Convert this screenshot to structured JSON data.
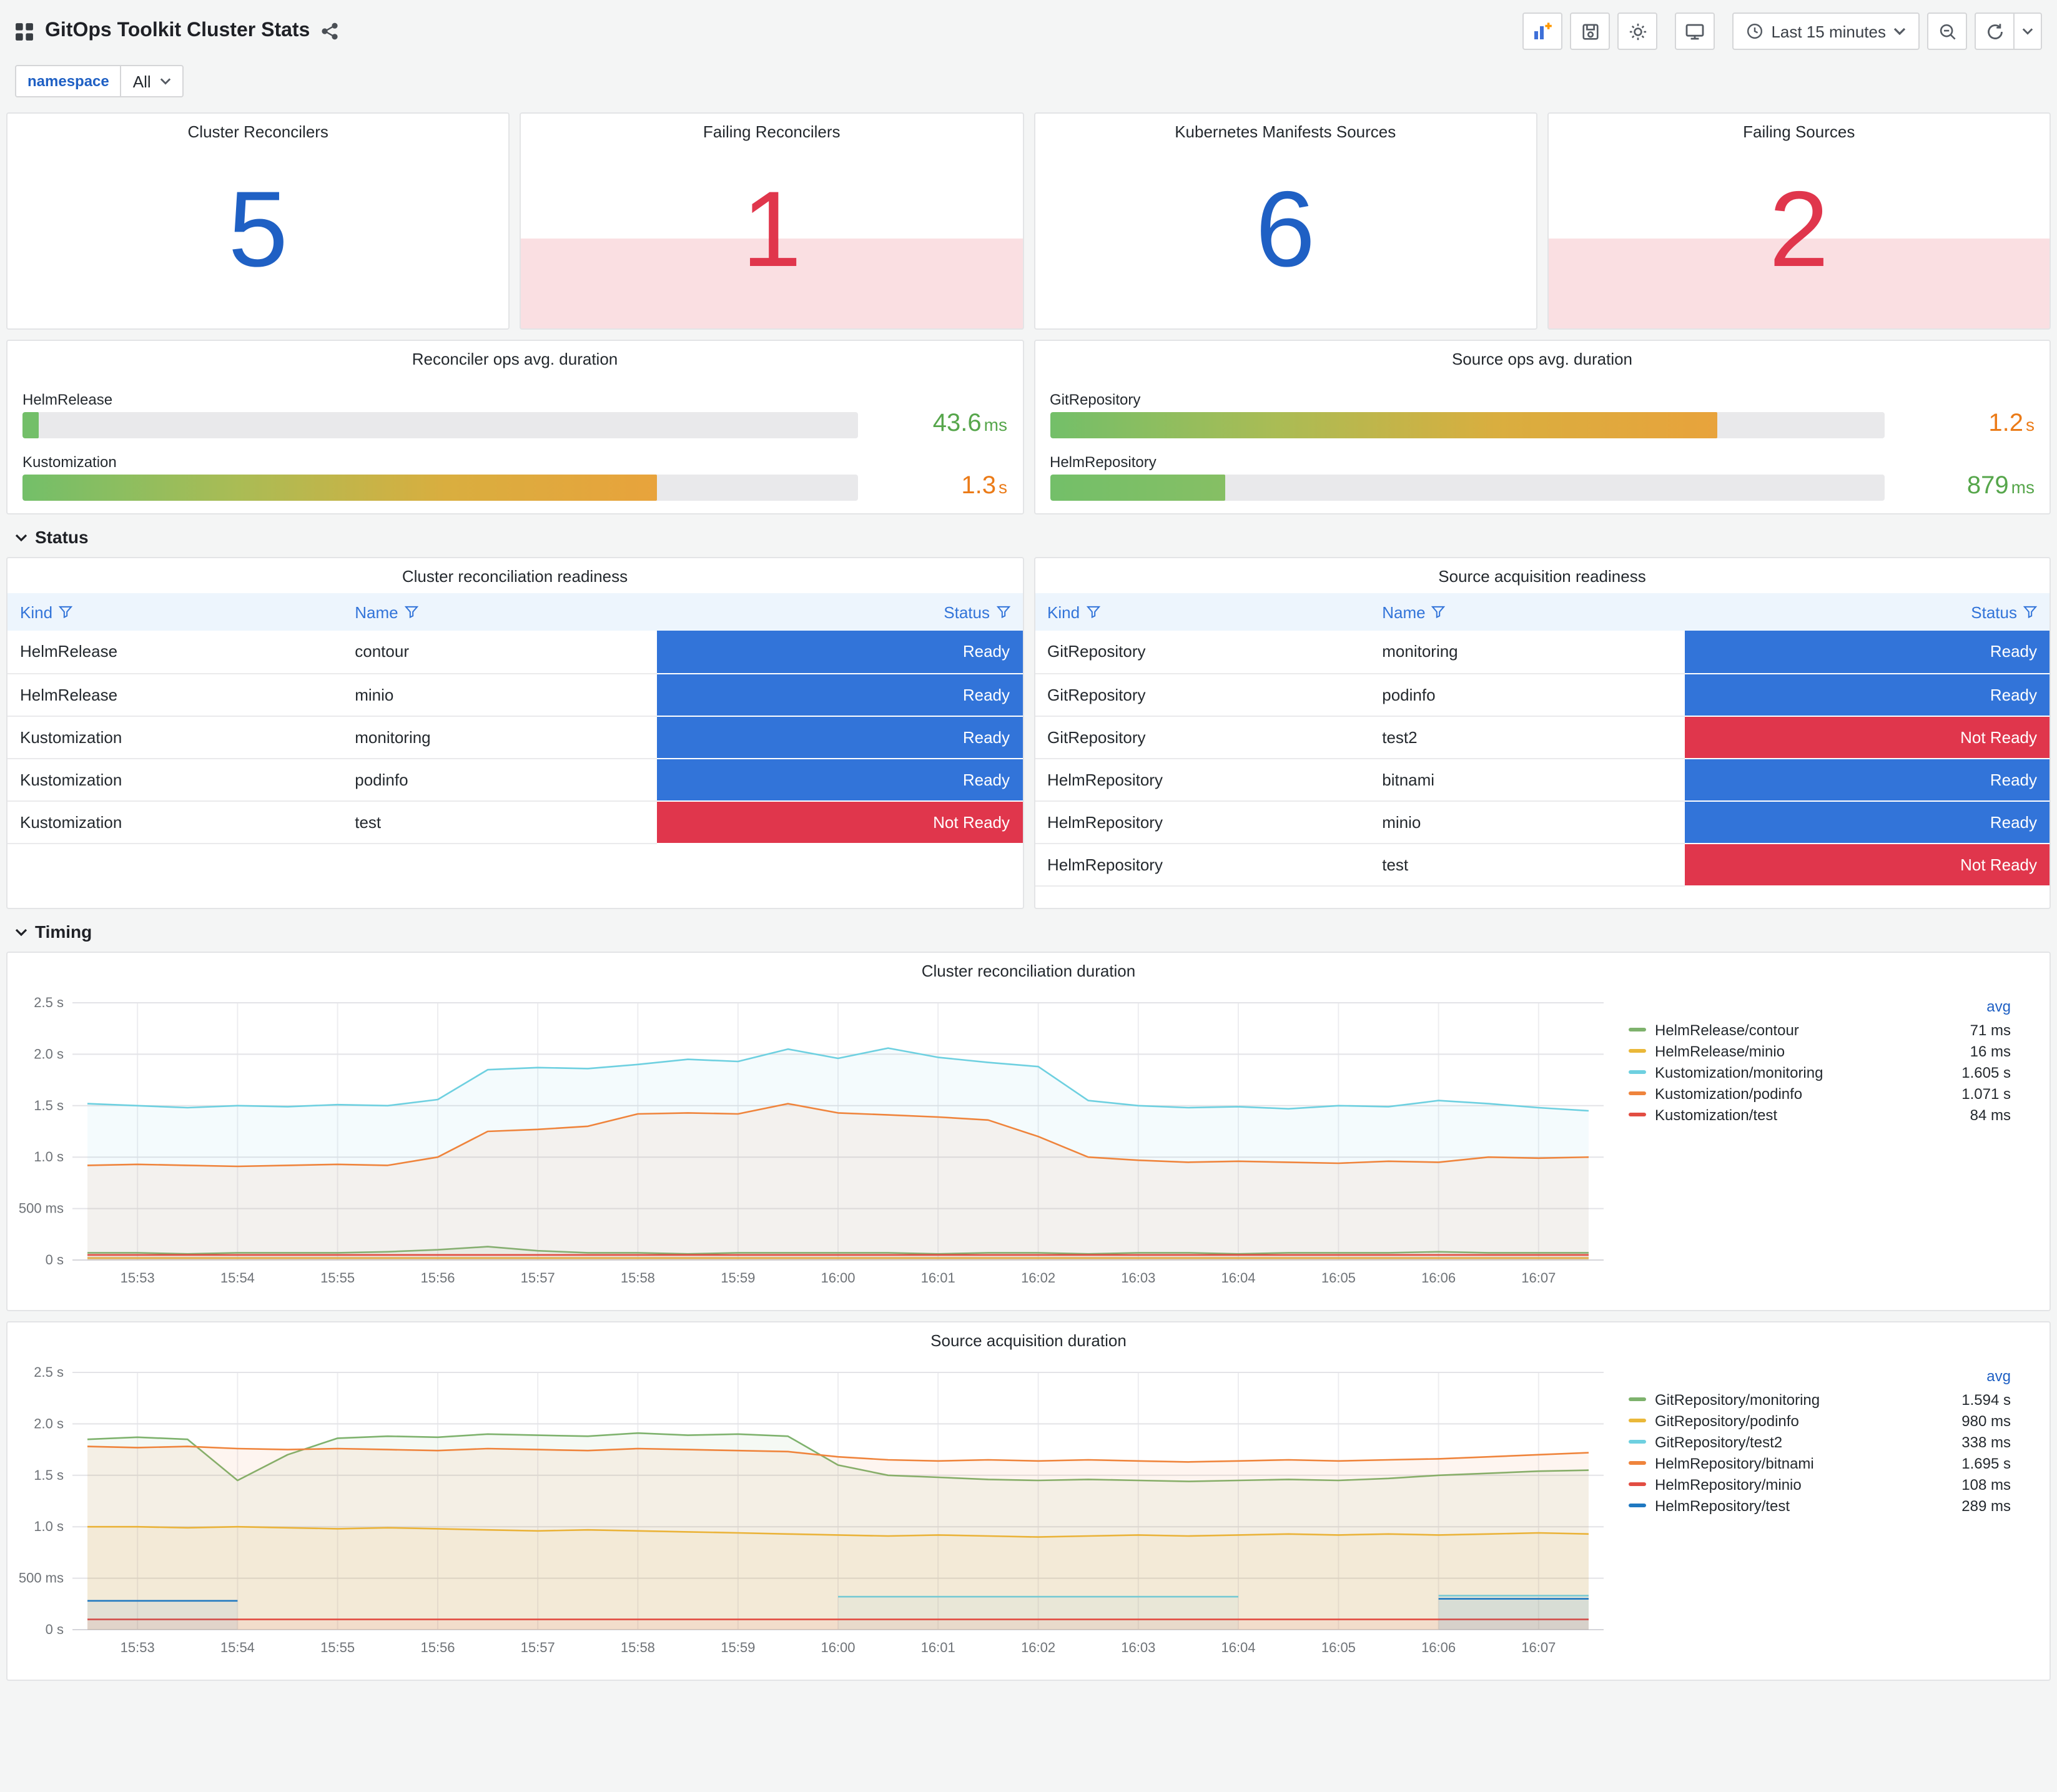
{
  "header": {
    "title": "GitOps Toolkit Cluster Stats",
    "time_range_label": "Last 15 minutes"
  },
  "variables": {
    "namespace_label": "namespace",
    "namespace_value": "All"
  },
  "colors": {
    "stat_ok": "#1F60C4",
    "stat_alert": "#E0364C",
    "ready_bg": "#3274D9",
    "not_ready_bg": "#E0364C",
    "gauge_green": "#73BF69",
    "gauge_orange": "#E8A33C"
  },
  "stats": [
    {
      "title": "Cluster Reconcilers",
      "value": "5",
      "state": "ok"
    },
    {
      "title": "Failing Reconcilers",
      "value": "1",
      "state": "alerting"
    },
    {
      "title": "Kubernetes Manifests Sources",
      "value": "6",
      "state": "ok"
    },
    {
      "title": "Failing Sources",
      "value": "2",
      "state": "alerting"
    }
  ],
  "gauges": [
    {
      "title": "Reconciler ops avg. duration",
      "rows": [
        {
          "label": "HelmRelease",
          "value": "43.6",
          "unit": "ms",
          "fill_pct": 2,
          "bar_colors": [
            "#73BF69",
            "#73BF69"
          ],
          "value_color": "#56A64B"
        },
        {
          "label": "Kustomization",
          "value": "1.3",
          "unit": "s",
          "fill_pct": 76,
          "bar_colors": [
            "#73BF69",
            "#A9BC55",
            "#D9AE3F",
            "#E8A33C"
          ],
          "value_color": "#EB7B18"
        }
      ]
    },
    {
      "title": "Source ops avg. duration",
      "rows": [
        {
          "label": "GitRepository",
          "value": "1.2",
          "unit": "s",
          "fill_pct": 80,
          "bar_colors": [
            "#73BF69",
            "#A9BC55",
            "#D9AE3F",
            "#E8A33C"
          ],
          "value_color": "#EB7B18"
        },
        {
          "label": "HelmRepository",
          "value": "879",
          "unit": "ms",
          "fill_pct": 21,
          "bar_colors": [
            "#73BF69",
            "#86BF64"
          ],
          "value_color": "#56A64B"
        }
      ]
    }
  ],
  "sections": {
    "status": "Status",
    "timing": "Timing"
  },
  "tables": [
    {
      "title": "Cluster reconciliation readiness",
      "columns": [
        "Kind",
        "Name",
        "Status"
      ],
      "rows": [
        {
          "kind": "HelmRelease",
          "name": "contour",
          "status": "Ready"
        },
        {
          "kind": "HelmRelease",
          "name": "minio",
          "status": "Ready"
        },
        {
          "kind": "Kustomization",
          "name": "monitoring",
          "status": "Ready"
        },
        {
          "kind": "Kustomization",
          "name": "podinfo",
          "status": "Ready"
        },
        {
          "kind": "Kustomization",
          "name": "test",
          "status": "Not Ready"
        }
      ]
    },
    {
      "title": "Source acquisition readiness",
      "columns": [
        "Kind",
        "Name",
        "Status"
      ],
      "rows": [
        {
          "kind": "GitRepository",
          "name": "monitoring",
          "status": "Ready"
        },
        {
          "kind": "GitRepository",
          "name": "podinfo",
          "status": "Ready"
        },
        {
          "kind": "GitRepository",
          "name": "test2",
          "status": "Not Ready"
        },
        {
          "kind": "HelmRepository",
          "name": "bitnami",
          "status": "Ready"
        },
        {
          "kind": "HelmRepository",
          "name": "minio",
          "status": "Ready"
        },
        {
          "kind": "HelmRepository",
          "name": "test",
          "status": "Not Ready"
        }
      ]
    }
  ],
  "chart_data": [
    {
      "type": "line",
      "title": "Cluster reconciliation duration",
      "legend_header": "avg",
      "ylim": [
        0,
        2.5
      ],
      "ytick_values": [
        0,
        0.5,
        1.0,
        1.5,
        2.0,
        2.5
      ],
      "ytick_labels": [
        "0 s",
        "500 ms",
        "1.0 s",
        "1.5 s",
        "2.0 s",
        "2.5 s"
      ],
      "x_start": 52.5,
      "x_step": 0.5,
      "xticks": [
        {
          "v": 53,
          "label": "15:53"
        },
        {
          "v": 54,
          "label": "15:54"
        },
        {
          "v": 55,
          "label": "15:55"
        },
        {
          "v": 56,
          "label": "15:56"
        },
        {
          "v": 57,
          "label": "15:57"
        },
        {
          "v": 58,
          "label": "15:58"
        },
        {
          "v": 59,
          "label": "15:59"
        },
        {
          "v": 60,
          "label": "16:00"
        },
        {
          "v": 61,
          "label": "16:01"
        },
        {
          "v": 62,
          "label": "16:02"
        },
        {
          "v": 63,
          "label": "16:03"
        },
        {
          "v": 64,
          "label": "16:04"
        },
        {
          "v": 65,
          "label": "16:05"
        },
        {
          "v": 66,
          "label": "16:06"
        },
        {
          "v": 67,
          "label": "16:07"
        }
      ],
      "series": [
        {
          "name": "HelmRelease/contour",
          "color": "#7EB26D",
          "avg": "71 ms",
          "values": [
            0.07,
            0.07,
            0.06,
            0.07,
            0.07,
            0.07,
            0.08,
            0.1,
            0.13,
            0.09,
            0.07,
            0.07,
            0.06,
            0.07,
            0.07,
            0.07,
            0.07,
            0.06,
            0.07,
            0.07,
            0.06,
            0.07,
            0.07,
            0.06,
            0.07,
            0.07,
            0.07,
            0.08,
            0.07,
            0.07,
            0.07
          ]
        },
        {
          "name": "HelmRelease/minio",
          "color": "#EAB839",
          "avg": "16 ms",
          "values": [
            0.02,
            0.02,
            0.02,
            0.02,
            0.02,
            0.02,
            0.02,
            0.02,
            0.02,
            0.02,
            0.02,
            0.02,
            0.02,
            0.02,
            0.02,
            0.02,
            0.02,
            0.02,
            0.02,
            0.02,
            0.02,
            0.02,
            0.02,
            0.02,
            0.02,
            0.02,
            0.02,
            0.02,
            0.02,
            0.02,
            0.02
          ]
        },
        {
          "name": "Kustomization/monitoring",
          "color": "#6ED0E0",
          "avg": "1.605 s",
          "values": [
            1.52,
            1.5,
            1.48,
            1.5,
            1.49,
            1.51,
            1.5,
            1.56,
            1.85,
            1.87,
            1.86,
            1.9,
            1.95,
            1.93,
            2.05,
            1.96,
            2.06,
            1.97,
            1.92,
            1.88,
            1.55,
            1.5,
            1.48,
            1.49,
            1.47,
            1.5,
            1.49,
            1.55,
            1.52,
            1.48,
            1.45
          ]
        },
        {
          "name": "Kustomization/podinfo",
          "color": "#EF843C",
          "avg": "1.071 s",
          "values": [
            0.92,
            0.93,
            0.92,
            0.91,
            0.92,
            0.93,
            0.92,
            1.0,
            1.25,
            1.27,
            1.3,
            1.42,
            1.43,
            1.42,
            1.52,
            1.43,
            1.41,
            1.39,
            1.36,
            1.2,
            1.0,
            0.97,
            0.95,
            0.96,
            0.95,
            0.94,
            0.96,
            0.95,
            1.0,
            0.99,
            1.0
          ]
        },
        {
          "name": "Kustomization/test",
          "color": "#E24D42",
          "avg": "84 ms",
          "values": [
            0.05,
            0.05,
            0.05,
            0.05,
            0.05,
            0.05,
            0.05,
            0.05,
            0.05,
            0.05,
            0.05,
            0.05,
            0.05,
            0.05,
            0.05,
            0.05,
            0.05,
            0.05,
            0.05,
            0.05,
            0.05,
            0.05,
            0.05,
            0.05,
            0.05,
            0.05,
            0.05,
            0.05,
            0.05,
            0.05,
            0.05
          ]
        }
      ]
    },
    {
      "type": "line",
      "title": "Source acquisition duration",
      "legend_header": "avg",
      "ylim": [
        0,
        2.5
      ],
      "ytick_values": [
        0,
        0.5,
        1.0,
        1.5,
        2.0,
        2.5
      ],
      "ytick_labels": [
        "0 s",
        "500 ms",
        "1.0 s",
        "1.5 s",
        "2.0 s",
        "2.5 s"
      ],
      "x_start": 52.5,
      "x_step": 0.5,
      "xticks": [
        {
          "v": 53,
          "label": "15:53"
        },
        {
          "v": 54,
          "label": "15:54"
        },
        {
          "v": 55,
          "label": "15:55"
        },
        {
          "v": 56,
          "label": "15:56"
        },
        {
          "v": 57,
          "label": "15:57"
        },
        {
          "v": 58,
          "label": "15:58"
        },
        {
          "v": 59,
          "label": "15:59"
        },
        {
          "v": 60,
          "label": "16:00"
        },
        {
          "v": 61,
          "label": "16:01"
        },
        {
          "v": 62,
          "label": "16:02"
        },
        {
          "v": 63,
          "label": "16:03"
        },
        {
          "v": 64,
          "label": "16:04"
        },
        {
          "v": 65,
          "label": "16:05"
        },
        {
          "v": 66,
          "label": "16:06"
        },
        {
          "v": 67,
          "label": "16:07"
        }
      ],
      "series": [
        {
          "name": "GitRepository/monitoring",
          "color": "#7EB26D",
          "avg": "1.594 s",
          "values": [
            1.85,
            1.87,
            1.85,
            1.45,
            1.7,
            1.86,
            1.88,
            1.87,
            1.9,
            1.89,
            1.88,
            1.91,
            1.89,
            1.9,
            1.88,
            1.6,
            1.5,
            1.48,
            1.46,
            1.45,
            1.46,
            1.45,
            1.44,
            1.45,
            1.46,
            1.45,
            1.47,
            1.5,
            1.52,
            1.54,
            1.55
          ]
        },
        {
          "name": "GitRepository/podinfo",
          "color": "#EAB839",
          "avg": "980 ms",
          "values": [
            1.0,
            1.0,
            0.99,
            1.0,
            0.99,
            0.98,
            0.99,
            0.98,
            0.97,
            0.96,
            0.97,
            0.96,
            0.95,
            0.94,
            0.93,
            0.92,
            0.91,
            0.92,
            0.91,
            0.9,
            0.91,
            0.92,
            0.91,
            0.92,
            0.93,
            0.92,
            0.93,
            0.92,
            0.93,
            0.94,
            0.93
          ]
        },
        {
          "name": "GitRepository/test2",
          "color": "#6ED0E0",
          "avg": "338 ms",
          "values": [
            null,
            null,
            null,
            null,
            null,
            null,
            null,
            null,
            null,
            null,
            null,
            null,
            null,
            null,
            null,
            0.32,
            0.32,
            0.32,
            0.32,
            0.32,
            0.32,
            0.32,
            0.32,
            0.32,
            null,
            null,
            null,
            0.33,
            0.33,
            0.33,
            0.33
          ]
        },
        {
          "name": "HelmRepository/bitnami",
          "color": "#EF843C",
          "avg": "1.695 s",
          "values": [
            1.78,
            1.77,
            1.78,
            1.76,
            1.75,
            1.76,
            1.75,
            1.74,
            1.76,
            1.75,
            1.74,
            1.76,
            1.75,
            1.74,
            1.73,
            1.68,
            1.65,
            1.64,
            1.65,
            1.64,
            1.65,
            1.64,
            1.63,
            1.64,
            1.65,
            1.64,
            1.65,
            1.66,
            1.68,
            1.7,
            1.72
          ]
        },
        {
          "name": "HelmRepository/minio",
          "color": "#E24D42",
          "avg": "108 ms",
          "values": [
            0.1,
            0.1,
            0.1,
            0.1,
            0.1,
            0.1,
            0.1,
            0.1,
            0.1,
            0.1,
            0.1,
            0.1,
            0.1,
            0.1,
            0.1,
            0.1,
            0.1,
            0.1,
            0.1,
            0.1,
            0.1,
            0.1,
            0.1,
            0.1,
            0.1,
            0.1,
            0.1,
            0.1,
            0.1,
            0.1,
            0.1
          ]
        },
        {
          "name": "HelmRepository/test",
          "color": "#1F78C1",
          "avg": "289 ms",
          "values": [
            0.28,
            0.28,
            0.28,
            0.28,
            null,
            null,
            null,
            null,
            null,
            null,
            null,
            null,
            null,
            null,
            null,
            null,
            null,
            null,
            null,
            null,
            null,
            null,
            null,
            null,
            null,
            null,
            null,
            0.3,
            0.3,
            0.3,
            0.3
          ]
        }
      ]
    }
  ]
}
